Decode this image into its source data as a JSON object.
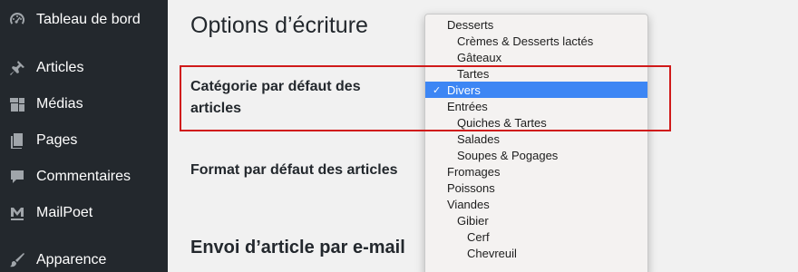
{
  "sidebar": {
    "items": [
      {
        "label": "Tableau de bord",
        "icon": "dashboard-icon"
      },
      {
        "label": "Articles",
        "icon": "pin-icon"
      },
      {
        "label": "Médias",
        "icon": "media-icon"
      },
      {
        "label": "Pages",
        "icon": "pages-icon"
      },
      {
        "label": "Commentaires",
        "icon": "comment-icon"
      },
      {
        "label": "MailPoet",
        "icon": "mailpoet-icon"
      },
      {
        "label": "Apparence",
        "icon": "brush-icon"
      }
    ]
  },
  "main": {
    "title": "Options d’écriture",
    "default_category_label": "Catégorie par défaut des articles",
    "default_format_label": "Format par défaut des articles",
    "post_by_email_heading": "Envoi d’article par e-mail"
  },
  "dropdown": {
    "selected": "Divers",
    "options": [
      {
        "label": "Desserts",
        "level": 0
      },
      {
        "label": "Crèmes & Desserts lactés",
        "level": 1
      },
      {
        "label": "Gâteaux",
        "level": 1
      },
      {
        "label": "Tartes",
        "level": 1
      },
      {
        "label": "Divers",
        "level": 0,
        "selected": true,
        "check": "✓"
      },
      {
        "label": "Entrées",
        "level": 0
      },
      {
        "label": "Quiches & Tartes",
        "level": 1
      },
      {
        "label": "Salades",
        "level": 1
      },
      {
        "label": "Soupes & Pogages",
        "level": 1
      },
      {
        "label": "Fromages",
        "level": 0
      },
      {
        "label": "Poissons",
        "level": 0
      },
      {
        "label": "Viandes",
        "level": 0
      },
      {
        "label": "Gibier",
        "level": 1
      },
      {
        "label": "Cerf",
        "level": 2
      },
      {
        "label": "Chevreuil",
        "level": 2
      }
    ]
  },
  "colors": {
    "sidebar_bg": "#23282d",
    "selected_bg": "#3d86f4",
    "highlight_border": "#d01a1a"
  }
}
